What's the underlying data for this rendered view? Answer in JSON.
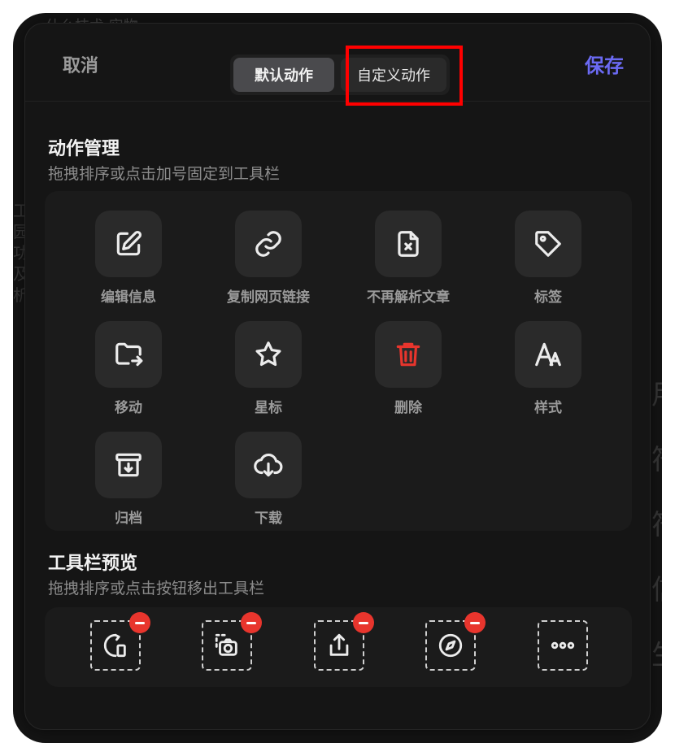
{
  "header": {
    "cancel_label": "取消",
    "save_label": "保存",
    "tabs": [
      {
        "label": "默认动作",
        "selected": true
      },
      {
        "label": "自定义动作",
        "selected": false
      }
    ]
  },
  "backdrop": {
    "top_text": "什么技术   实物",
    "left_text": "工园功及析",
    "right_text": "用符符信生"
  },
  "action_management": {
    "title": "动作管理",
    "subtitle": "拖拽排序或点击加号固定到工具栏",
    "actions": [
      {
        "label": "编辑信息",
        "icon": "edit-icon"
      },
      {
        "label": "复制网页链接",
        "icon": "link-icon"
      },
      {
        "label": "不再解析文章",
        "icon": "file-x-icon"
      },
      {
        "label": "标签",
        "icon": "tag-icon"
      },
      {
        "label": "移动",
        "icon": "folder-move-icon"
      },
      {
        "label": "星标",
        "icon": "star-icon"
      },
      {
        "label": "删除",
        "icon": "trash-icon",
        "color": "#e8352d"
      },
      {
        "label": "样式",
        "icon": "font-style-icon"
      },
      {
        "label": "归档",
        "icon": "archive-icon"
      },
      {
        "label": "下载",
        "icon": "cloud-download-icon"
      }
    ]
  },
  "toolbar_preview": {
    "title": "工具栏预览",
    "subtitle": "拖拽排序或点击按钮移出工具栏",
    "items": [
      {
        "icon": "refresh-device-icon",
        "removable": true
      },
      {
        "icon": "screenshot-icon",
        "removable": true
      },
      {
        "icon": "share-icon",
        "removable": true
      },
      {
        "icon": "compass-icon",
        "removable": true
      },
      {
        "icon": "more-icon",
        "removable": false
      }
    ]
  },
  "colors": {
    "accent": "#6b6af3",
    "danger": "#e8352d",
    "highlight": "#ff0000"
  }
}
